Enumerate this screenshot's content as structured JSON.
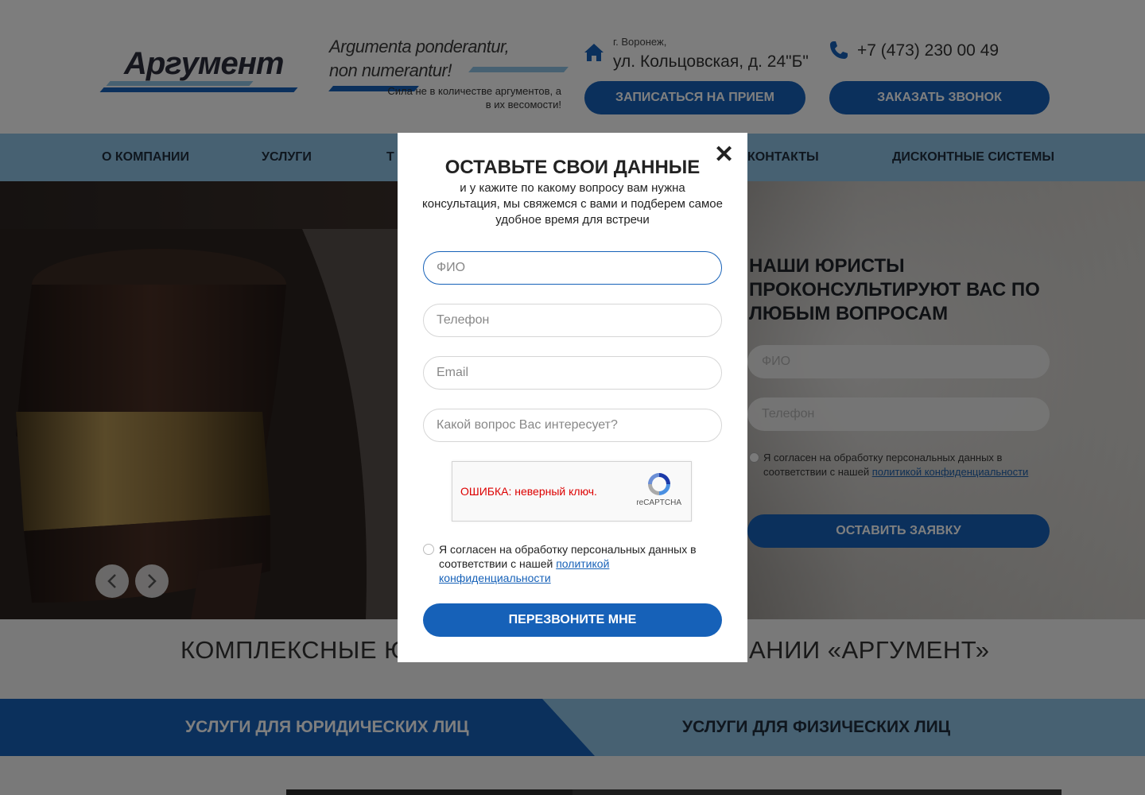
{
  "header": {
    "logo_text": "Аргумент",
    "motto_line1": "Argumenta ponderantur,",
    "motto_line2": "non numerantur!",
    "motto_sub": "Сила не в количестве аргументов, а в их весомости!",
    "city": "г. Воронеж,",
    "street": "ул. Кольцовская, д. 24\"Б\"",
    "phone": "+7 (473) 230 00 49",
    "btn_appoint": "Записаться на прием",
    "btn_callback": "Заказать звонок",
    "icons": {
      "address": "home-icon",
      "phone": "phone-icon"
    }
  },
  "nav": {
    "items": [
      "О компании",
      "Услуги",
      "Т",
      "Контакты",
      "Дисконтные системы"
    ]
  },
  "hero": {
    "title": "Наши юристы проконсультируют вас по любым вопросам",
    "field_name_placeholder": "ФИО",
    "field_phone_placeholder": "Телефон",
    "consent_text": "Я согласен на обработку персональных данных в соответствии с нашей",
    "consent_link": "политикой конфиденциальности",
    "submit": "Оставить заявку",
    "prev_icon": "chevron-left-icon",
    "next_icon": "chevron-right-icon"
  },
  "section": {
    "complex_left": "КОМПЛЕКСНЫЕ ЮР",
    "complex_right": "АНИИ «АРГУМЕНТ»",
    "services_legal": "Услуги для юридических лиц",
    "services_individual": "Услуги для физических лиц"
  },
  "modal": {
    "title": "ОСТАВЬТЕ СВОИ ДАННЫЕ",
    "description": "и у кажите по какому вопросу вам нужна консультация, мы свяжемся с вами и подберем самое удобное время для встречи",
    "name_placeholder": "ФИО",
    "phone_placeholder": "Телефон",
    "email_placeholder": "Email",
    "question_placeholder": "Какой вопрос Вас интересует?",
    "recaptcha_error": "ОШИБКА: неверный ключ.",
    "recaptcha_label": "reCAPTCHA",
    "consent_text": "Я согласен на обработку персональных данных в соответствии с нашей",
    "consent_link": "политикой конфиденциальности",
    "submit": "ПЕРЕЗВОНИТЕ МНЕ",
    "close_icon": "close-icon"
  },
  "colors": {
    "accent": "#1661b8",
    "nav_bg": "#8ec3e4",
    "error": "#dd0000"
  }
}
